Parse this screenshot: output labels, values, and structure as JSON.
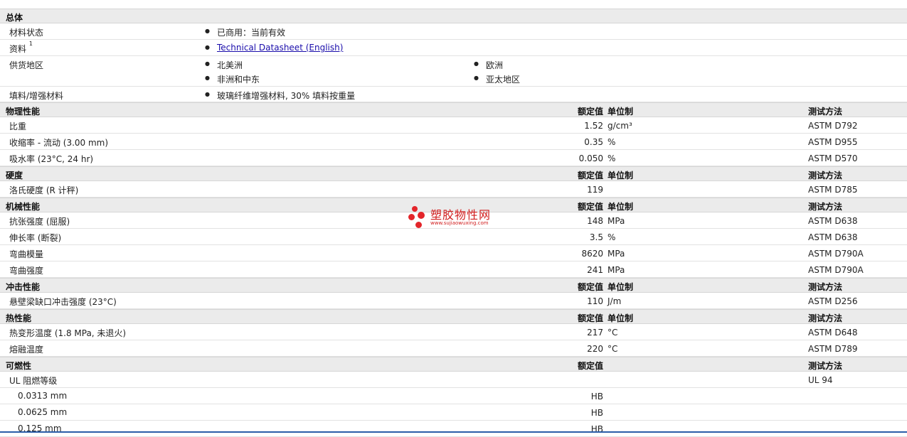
{
  "general": {
    "title": "总体",
    "material_status_label": "材料状态",
    "material_status_value": "已商用：当前有效",
    "info_label": "资料",
    "info_sup": "1",
    "info_link": "Technical Datasheet (English)",
    "supply_label": "供货地区",
    "supply": [
      "北美洲",
      "欧洲",
      "非洲和中东",
      "亚太地区"
    ],
    "filler_label": "填料/增强材料",
    "filler_value": "玻璃纤维增强材料, 30% 填料按重量"
  },
  "col_headers": {
    "value": "额定值",
    "unit": "单位制",
    "test": "测试方法"
  },
  "sections": [
    {
      "title": "物理性能",
      "rows": [
        {
          "label": "比重",
          "value": "1.52",
          "unit": "g/cm³",
          "test": "ASTM D792"
        },
        {
          "label": "收缩率 - 流动 (3.00 mm)",
          "value": "0.35",
          "unit": "%",
          "test": "ASTM D955"
        },
        {
          "label": "吸水率 (23°C, 24 hr)",
          "value": "0.050",
          "unit": "%",
          "test": "ASTM D570"
        }
      ]
    },
    {
      "title": "硬度",
      "rows": [
        {
          "label": "洛氏硬度 (R 计秤)",
          "value": "119",
          "unit": "",
          "test": "ASTM D785"
        }
      ]
    },
    {
      "title": "机械性能",
      "rows": [
        {
          "label": "抗张强度 (屈服)",
          "value": "148",
          "unit": "MPa",
          "test": "ASTM D638"
        },
        {
          "label": "伸长率 (断裂)",
          "value": "3.5",
          "unit": "%",
          "test": "ASTM D638"
        },
        {
          "label": "弯曲模量",
          "value": "8620",
          "unit": "MPa",
          "test": "ASTM D790A"
        },
        {
          "label": "弯曲强度",
          "value": "241",
          "unit": "MPa",
          "test": "ASTM D790A"
        }
      ]
    },
    {
      "title": "冲击性能",
      "rows": [
        {
          "label": "悬壁梁缺口冲击强度 (23°C)",
          "value": "110",
          "unit": "J/m",
          "test": "ASTM D256"
        }
      ]
    },
    {
      "title": "热性能",
      "rows": [
        {
          "label": "热变形温度 (1.8 MPa, 未退火)",
          "value": "217",
          "unit": "°C",
          "test": "ASTM D648"
        },
        {
          "label": "熔融温度",
          "value": "220",
          "unit": "°C",
          "test": "ASTM D789"
        }
      ]
    }
  ],
  "flammability": {
    "title": "可燃性",
    "ul_label": "UL 阻燃等级",
    "ul_test": "UL 94",
    "rows": [
      {
        "label": "0.0313 mm",
        "value": "HB"
      },
      {
        "label": "0.0625 mm",
        "value": "HB"
      },
      {
        "label": "0.125 mm",
        "value": "HB"
      }
    ]
  },
  "watermark": {
    "cn": "塑胶物性网",
    "en": "www.sujiaowuxing.com",
    "color": "#e3252a"
  }
}
